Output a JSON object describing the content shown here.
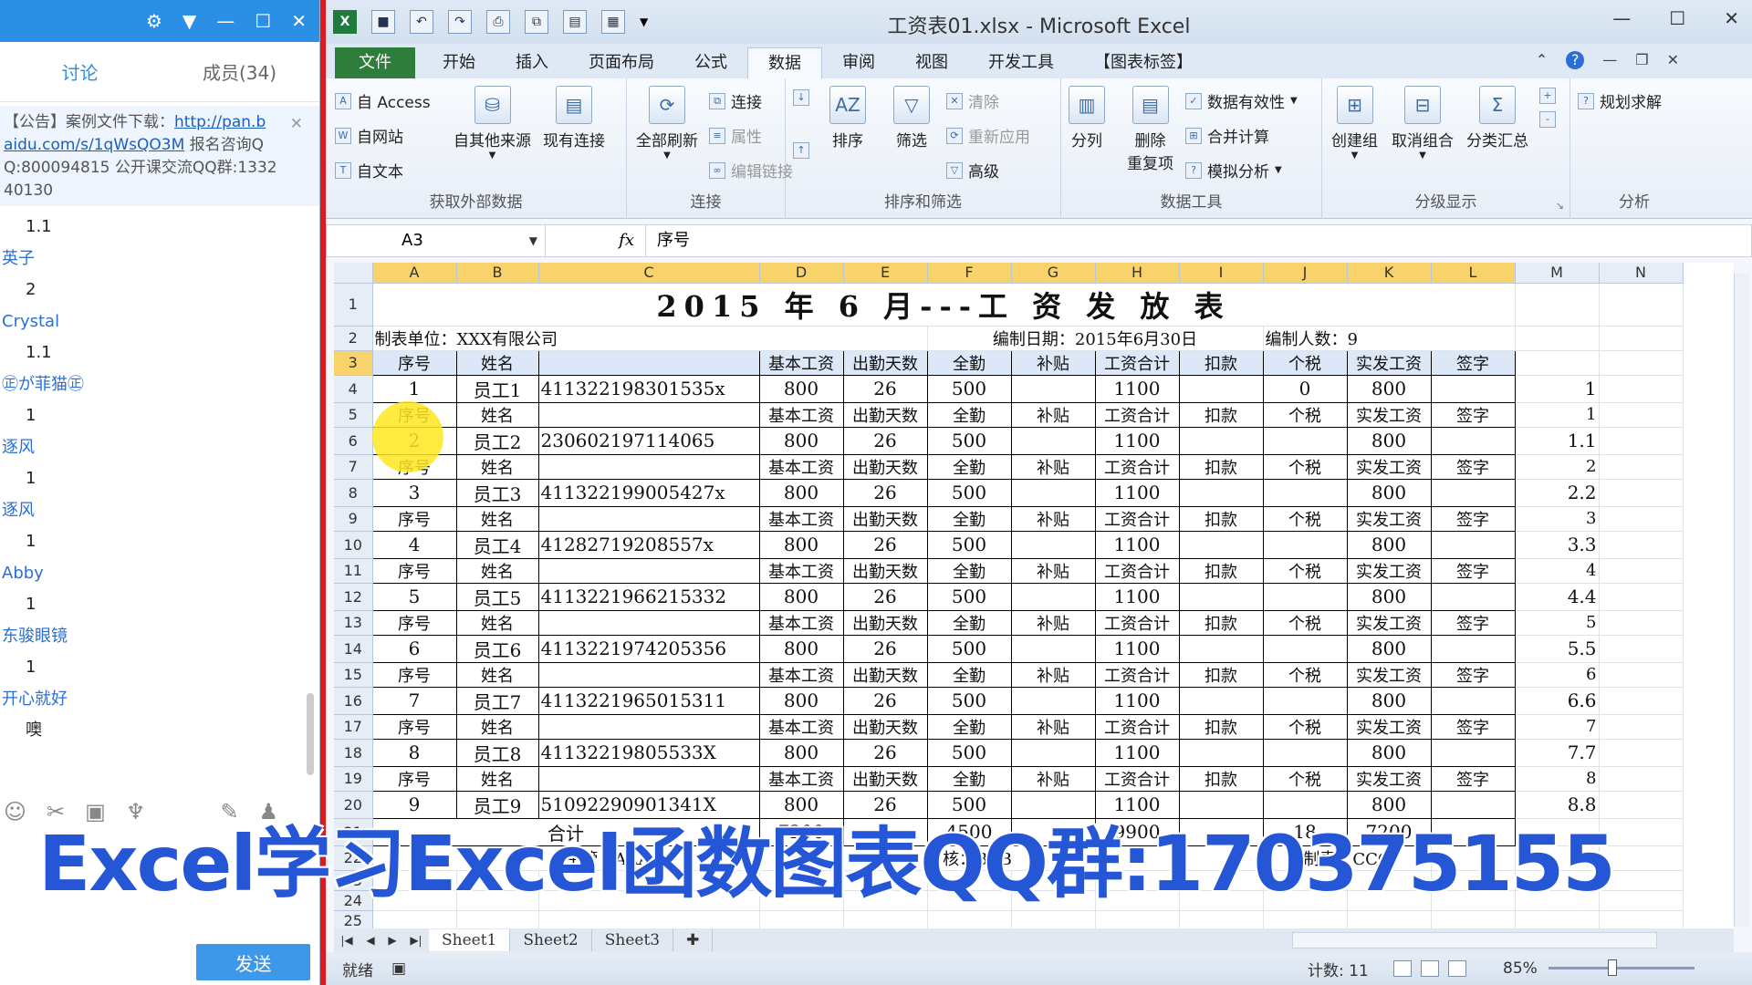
{
  "chat": {
    "tabs": [
      "讨论",
      "成员(34)"
    ],
    "notice": {
      "prefix": "【公告】",
      "text1": "案例文件下载：",
      "link": "http://pan.baidu.com/s/1qWsQO3M",
      "link_part1": "http://pan.b",
      "link_part2": "aidu.com/s/1qWsQO3M",
      "text2": " 报名咨询Q",
      "text3": "Q:800094815  公开课交流QQ群:1332",
      "text4": "40130"
    },
    "messages": [
      {
        "name": "",
        "text": "1.1"
      },
      {
        "name": "英子",
        "text": "2"
      },
      {
        "name": "Crystal",
        "text": "1.1"
      },
      {
        "name": "㊣が菲猫㊣",
        "text": "1"
      },
      {
        "name": "逐风",
        "text": "1"
      },
      {
        "name": "逐风",
        "text": "1"
      },
      {
        "name": "Abby",
        "text": "1"
      },
      {
        "name": "东骏眼镜",
        "text": "1"
      },
      {
        "name": "开心就好",
        "text": "噢"
      }
    ],
    "send_label": "发送"
  },
  "excel": {
    "window_title": "工资表01.xlsx - Microsoft Excel",
    "tabs": [
      "文件",
      "开始",
      "插入",
      "页面布局",
      "公式",
      "数据",
      "审阅",
      "视图",
      "开发工具",
      "【图表标签】"
    ],
    "ribbon": {
      "access": "自 Access",
      "web": "自网站",
      "text": "自文本",
      "other": "自其他来源",
      "existing": "现有连接",
      "refresh": "全部刷新",
      "connections": "连接",
      "properties": "属性",
      "edit_links": "编辑链接",
      "sort": "排序",
      "filter": "筛选",
      "clear": "清除",
      "reapply": "重新应用",
      "advanced": "高级",
      "split": "分列",
      "remove_dup_1": "删除",
      "remove_dup_2": "重复项",
      "validation": "数据有效性",
      "consolidate": "合并计算",
      "whatif": "模拟分析",
      "group": "创建组",
      "ungroup": "取消组合",
      "subtotal": "分类汇总",
      "solver": "规划求解",
      "group_labels": [
        "获取外部数据",
        "连接",
        "排序和筛选",
        "数据工具",
        "分级显示",
        "分析"
      ]
    },
    "name_box": "A3",
    "formula": "序号",
    "columns": [
      "A",
      "B",
      "C",
      "D",
      "E",
      "F",
      "G",
      "H",
      "I",
      "J",
      "K",
      "L",
      "M",
      "N"
    ],
    "title": "2015 年 6 月---工  资  发  放  表",
    "row2": {
      "unit": "制表单位：XXX有限公司",
      "date": "编制日期：2015年6月30日",
      "count": "编制人数：9"
    },
    "header": [
      "序号",
      "姓名",
      "",
      "基本工资",
      "出勤天数",
      "全勤",
      "补贴",
      "工资合计",
      "扣款",
      "个税",
      "实发工资",
      "签字"
    ],
    "employees": [
      {
        "no": "1",
        "name": "员工1",
        "id": "411322198301535x",
        "base": "800",
        "days": "26",
        "bonus": "500",
        "total": "1100",
        "tax": "0",
        "net": "800",
        "m": "1"
      },
      {
        "no": "2",
        "name": "员工2",
        "id": "230602197114065",
        "base": "800",
        "days": "26",
        "bonus": "500",
        "total": "1100",
        "tax": "",
        "net": "800",
        "m": "1.1"
      },
      {
        "no": "3",
        "name": "员工3",
        "id": "411322199005427x",
        "base": "800",
        "days": "26",
        "bonus": "500",
        "total": "1100",
        "tax": "",
        "net": "800",
        "m": "2.2"
      },
      {
        "no": "4",
        "name": "员工4",
        "id": "41282719208557x",
        "base": "800",
        "days": "26",
        "bonus": "500",
        "total": "1100",
        "tax": "",
        "net": "800",
        "m": "3.3"
      },
      {
        "no": "5",
        "name": "员工5",
        "id": "4113221966215332",
        "base": "800",
        "days": "26",
        "bonus": "500",
        "total": "1100",
        "tax": "",
        "net": "800",
        "m": "4.4"
      },
      {
        "no": "6",
        "name": "员工6",
        "id": "4113221974205356",
        "base": "800",
        "days": "26",
        "bonus": "500",
        "total": "1100",
        "tax": "",
        "net": "800",
        "m": "5.5"
      },
      {
        "no": "7",
        "name": "员工7",
        "id": "4113221965015311",
        "base": "800",
        "days": "26",
        "bonus": "500",
        "total": "1100",
        "tax": "",
        "net": "800",
        "m": "6.6"
      },
      {
        "no": "8",
        "name": "员工8",
        "id": "41132219805533X",
        "base": "800",
        "days": "26",
        "bonus": "500",
        "total": "1100",
        "tax": "",
        "net": "800",
        "m": "7.7"
      },
      {
        "no": "9",
        "name": "员工9",
        "id": "51092290901341X",
        "base": "800",
        "days": "26",
        "bonus": "500",
        "total": "1100",
        "tax": "",
        "net": "800",
        "m": "8.8"
      }
    ],
    "header_m": [
      "1",
      "2",
      "3",
      "4",
      "5",
      "6",
      "7",
      "8"
    ],
    "totals": {
      "label": "合计",
      "base": "7200",
      "bonus": "4500",
      "total": "9900",
      "tax": "18",
      "net": "7200"
    },
    "footer": {
      "manager": "主管：AAA",
      "auditor": "审核：BBB",
      "maker": "制表：CCC"
    },
    "sheets": [
      "Sheet1",
      "Sheet2",
      "Sheet3"
    ],
    "status_ready": "就绪",
    "status_count": "计数: 11",
    "zoom": "85%"
  },
  "overlay_text": "Excel学习Excel函数图表QQ群:170375155"
}
